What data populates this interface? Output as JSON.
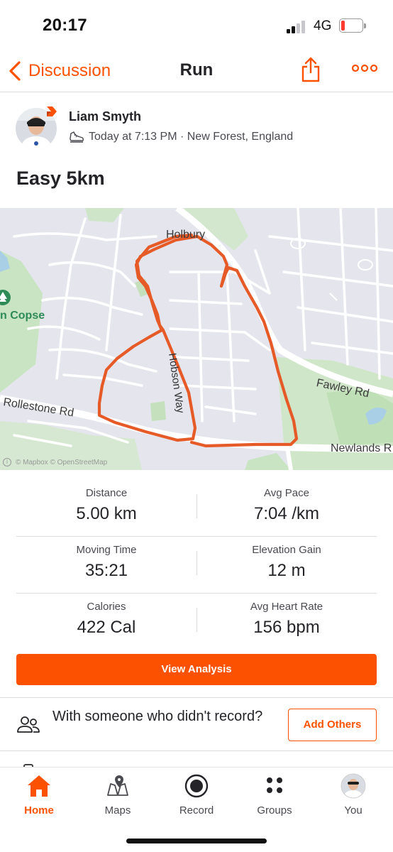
{
  "status_bar": {
    "time": "20:17",
    "network": "4G"
  },
  "nav": {
    "back_label": "Discussion",
    "title": "Run"
  },
  "athlete": {
    "name": "Liam Smyth",
    "meta": "Today at 7:13 PM · New Forest, England"
  },
  "activity": {
    "title": "Easy 5km"
  },
  "map": {
    "labels": {
      "holbury": "Holbury",
      "copse": "n Copse",
      "rollestone": "Rollestone Rd",
      "fawley": "Fawley Rd",
      "newlands": "Newlands R",
      "hobson": "Hobson Way"
    },
    "attribution": "© Mapbox © OpenStreetMap",
    "route_color": "#e65a28"
  },
  "stats": {
    "distance": {
      "label": "Distance",
      "value": "5.00 km"
    },
    "avg_pace": {
      "label": "Avg Pace",
      "value": "7:04 /km"
    },
    "moving_time": {
      "label": "Moving Time",
      "value": "35:21"
    },
    "elevation_gain": {
      "label": "Elevation Gain",
      "value": "12 m"
    },
    "calories": {
      "label": "Calories",
      "value": "422 Cal"
    },
    "avg_heart_rate": {
      "label": "Avg Heart Rate",
      "value": "156 bpm"
    }
  },
  "actions": {
    "view_analysis": "View Analysis"
  },
  "with_someone": {
    "text": "With someone who didn't record?",
    "button": "Add Others"
  },
  "tabs": [
    {
      "label": "Home",
      "icon": "home-icon",
      "active": true
    },
    {
      "label": "Maps",
      "icon": "maps-icon"
    },
    {
      "label": "Record",
      "icon": "record-icon"
    },
    {
      "label": "Groups",
      "icon": "groups-icon"
    },
    {
      "label": "You",
      "icon": "profile-avatar-icon"
    }
  ],
  "colors": {
    "accent": "#fc5200",
    "text": "#242428",
    "muted": "#494950",
    "battery_low": "#ff3b30"
  }
}
